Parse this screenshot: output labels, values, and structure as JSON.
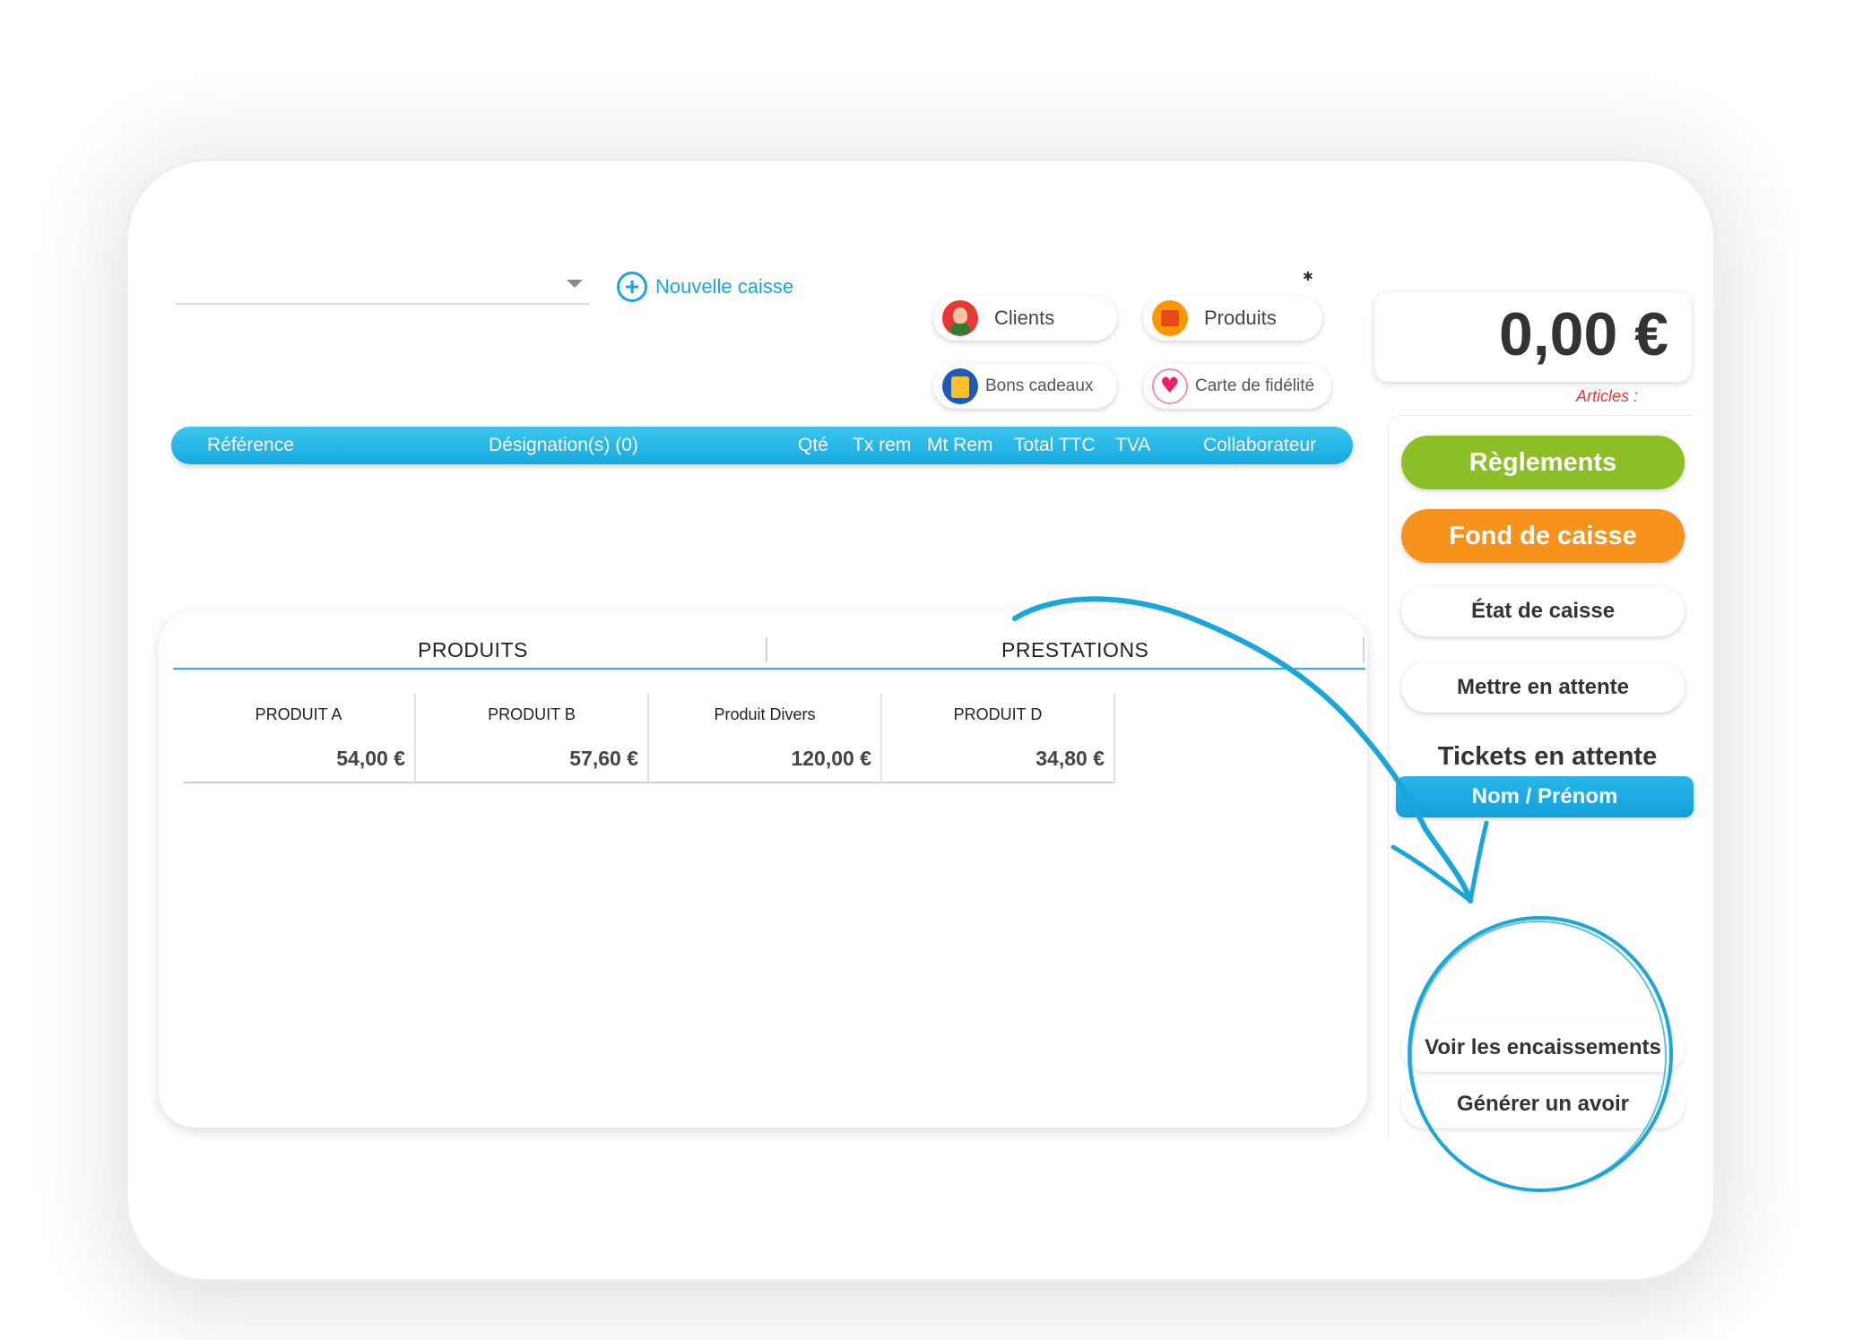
{
  "toolbar": {
    "new_register_label": "Nouvelle caisse",
    "pills": {
      "clients": "Clients",
      "produits": "Produits",
      "bons_cadeaux": "Bons cadeaux",
      "carte_fidelite": "Carte de fidélité"
    }
  },
  "table": {
    "columns": [
      "Référence",
      "Désignation(s) (0)",
      "Qté",
      "Tx rem",
      "Mt Rem",
      "Total TTC",
      "TVA",
      "Collaborateur"
    ]
  },
  "catalog": {
    "tabs": [
      "PRODUITS",
      "PRESTATIONS"
    ],
    "products": [
      {
        "name": "PRODUIT A",
        "price": "54,00 €"
      },
      {
        "name": "PRODUIT B",
        "price": "57,60 €"
      },
      {
        "name": "Produit Divers",
        "price": "120,00 €"
      },
      {
        "name": "PRODUIT D",
        "price": "34,80 €"
      }
    ]
  },
  "summary": {
    "total": "0,00 €",
    "articles_label": "Articles :"
  },
  "actions": {
    "reglements": "Règlements",
    "fond_de_caisse": "Fond de caisse",
    "etat_de_caisse": "État de caisse",
    "mettre_en_attente": "Mettre en attente",
    "tickets_title": "Tickets en attente",
    "tickets_column": "Nom / Prénom",
    "voir_encaissements": "Voir les encaissements",
    "generer_avoir": "Générer un avoir"
  },
  "colors": {
    "accent_blue": "#1aa6d9",
    "green": "#8bbf25",
    "orange": "#f7931d",
    "price_red": "#e53935"
  },
  "icons": [
    "plus-circle-icon",
    "caret-down-icon",
    "clients-icon",
    "produits-icon",
    "gift-icon",
    "loyalty-card-icon"
  ]
}
